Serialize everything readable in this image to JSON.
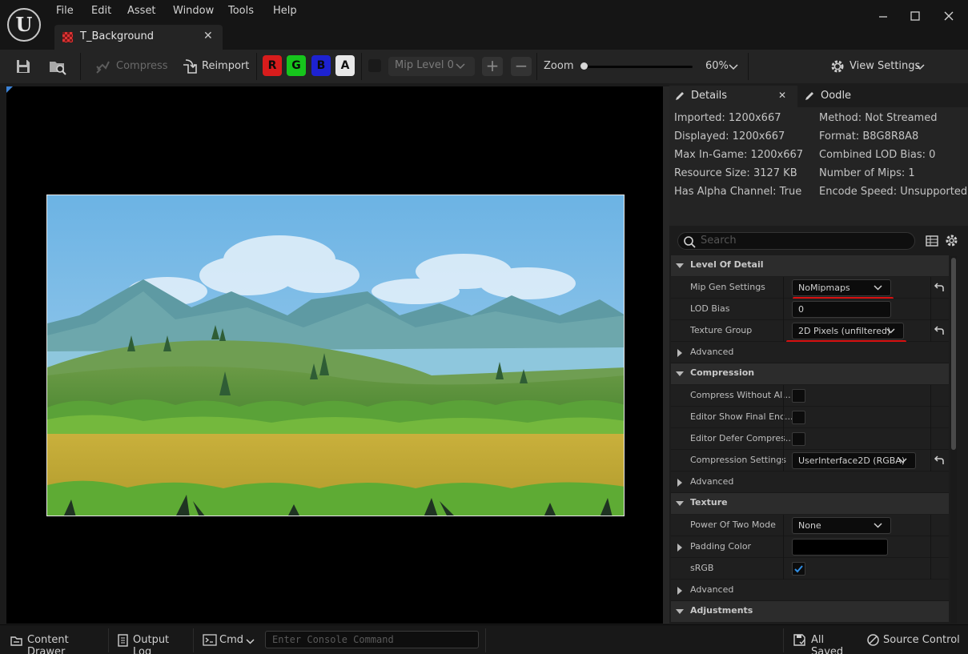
{
  "menu": [
    "File",
    "Edit",
    "Asset",
    "Window",
    "Tools",
    "Help"
  ],
  "tab": {
    "title": "T_Background"
  },
  "toolbar": {
    "compress": "Compress",
    "reimport": "Reimport",
    "channels": [
      "R",
      "G",
      "B",
      "A"
    ],
    "channel_colors": [
      "#d81c1c",
      "#16c51c",
      "#1d22d1",
      "#e8e8e8"
    ],
    "mip_level": "Mip Level 0",
    "zoom_label": "Zoom",
    "zoom_value": "60%",
    "zoom_fraction": 0.0,
    "view_settings": "View Settings"
  },
  "details": {
    "tab_details": "Details",
    "tab_oodle": "Oodle",
    "info_left": [
      "Imported: 1200x667",
      "Displayed: 1200x667",
      "Max In-Game: 1200x667",
      "Resource Size: 3127 KB",
      "Has Alpha Channel: True"
    ],
    "info_right": [
      "Method: Not Streamed",
      "Format: B8G8R8A8",
      "Combined LOD Bias: 0",
      "Number of Mips: 1",
      "Encode Speed: Unsupported"
    ],
    "search_placeholder": "Search",
    "sections": {
      "lod": "Level Of Detail",
      "compression": "Compression",
      "texture": "Texture",
      "adjustments": "Adjustments"
    },
    "props": {
      "mip_gen": {
        "label": "Mip Gen Settings",
        "value": "NoMipmaps"
      },
      "lod_bias": {
        "label": "LOD Bias",
        "value": "0"
      },
      "texture_group": {
        "label": "Texture Group",
        "value": "2D Pixels (unfiltered)"
      },
      "compress_without_alpha": {
        "label": "Compress Without Al...",
        "checked": false
      },
      "editor_show_final": {
        "label": "Editor Show Final Enc...",
        "checked": false
      },
      "editor_defer": {
        "label": "Editor Defer Compres...",
        "checked": false
      },
      "compression_settings": {
        "label": "Compression Settings",
        "value": "UserInterface2D (RGBA)"
      },
      "power_of_two": {
        "label": "Power Of Two Mode",
        "value": "None"
      },
      "padding_color": {
        "label": "Padding Color",
        "color": "#000000"
      },
      "srgb": {
        "label": "sRGB",
        "checked": true
      }
    },
    "advanced": "Advanced"
  },
  "statusbar": {
    "content_drawer": "Content Drawer",
    "output_log": "Output Log",
    "cmd": "Cmd",
    "console_placeholder": "Enter Console Command",
    "all_saved": "All Saved",
    "source_control": "Source Control"
  }
}
